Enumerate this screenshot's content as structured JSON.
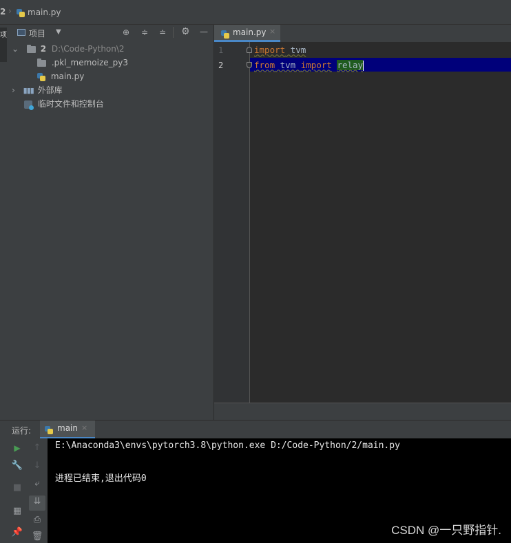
{
  "breadcrumb": {
    "project": "2",
    "file": "main.py"
  },
  "project_panel": {
    "title": "项目",
    "left_tab_glyph": "项",
    "tree": [
      {
        "label": "2",
        "path": "D:\\Code-Python\\2"
      },
      {
        "label": ".pkl_memoize_py3"
      },
      {
        "label": "main.py"
      },
      {
        "label": "外部库"
      },
      {
        "label": "临时文件和控制台"
      }
    ]
  },
  "editor": {
    "tab_label": "main.py",
    "lines": [
      {
        "num": "1",
        "parts": [
          "import",
          " tvm"
        ]
      },
      {
        "num": "2",
        "parts": [
          "from",
          " tvm ",
          "import",
          " ",
          "relay"
        ]
      }
    ]
  },
  "run": {
    "label": "运行:",
    "tab_label": "main",
    "console": [
      "E:\\Anaconda3\\envs\\pytorch3.8\\python.exe D:/Code-Python/2/main.py",
      "",
      "进程已结束,退出代码0"
    ]
  },
  "watermark": "CSDN @一只野指针.",
  "colors": {
    "accent": "#4a88c7",
    "selection": "#00007a",
    "run_green": "#499c54"
  }
}
